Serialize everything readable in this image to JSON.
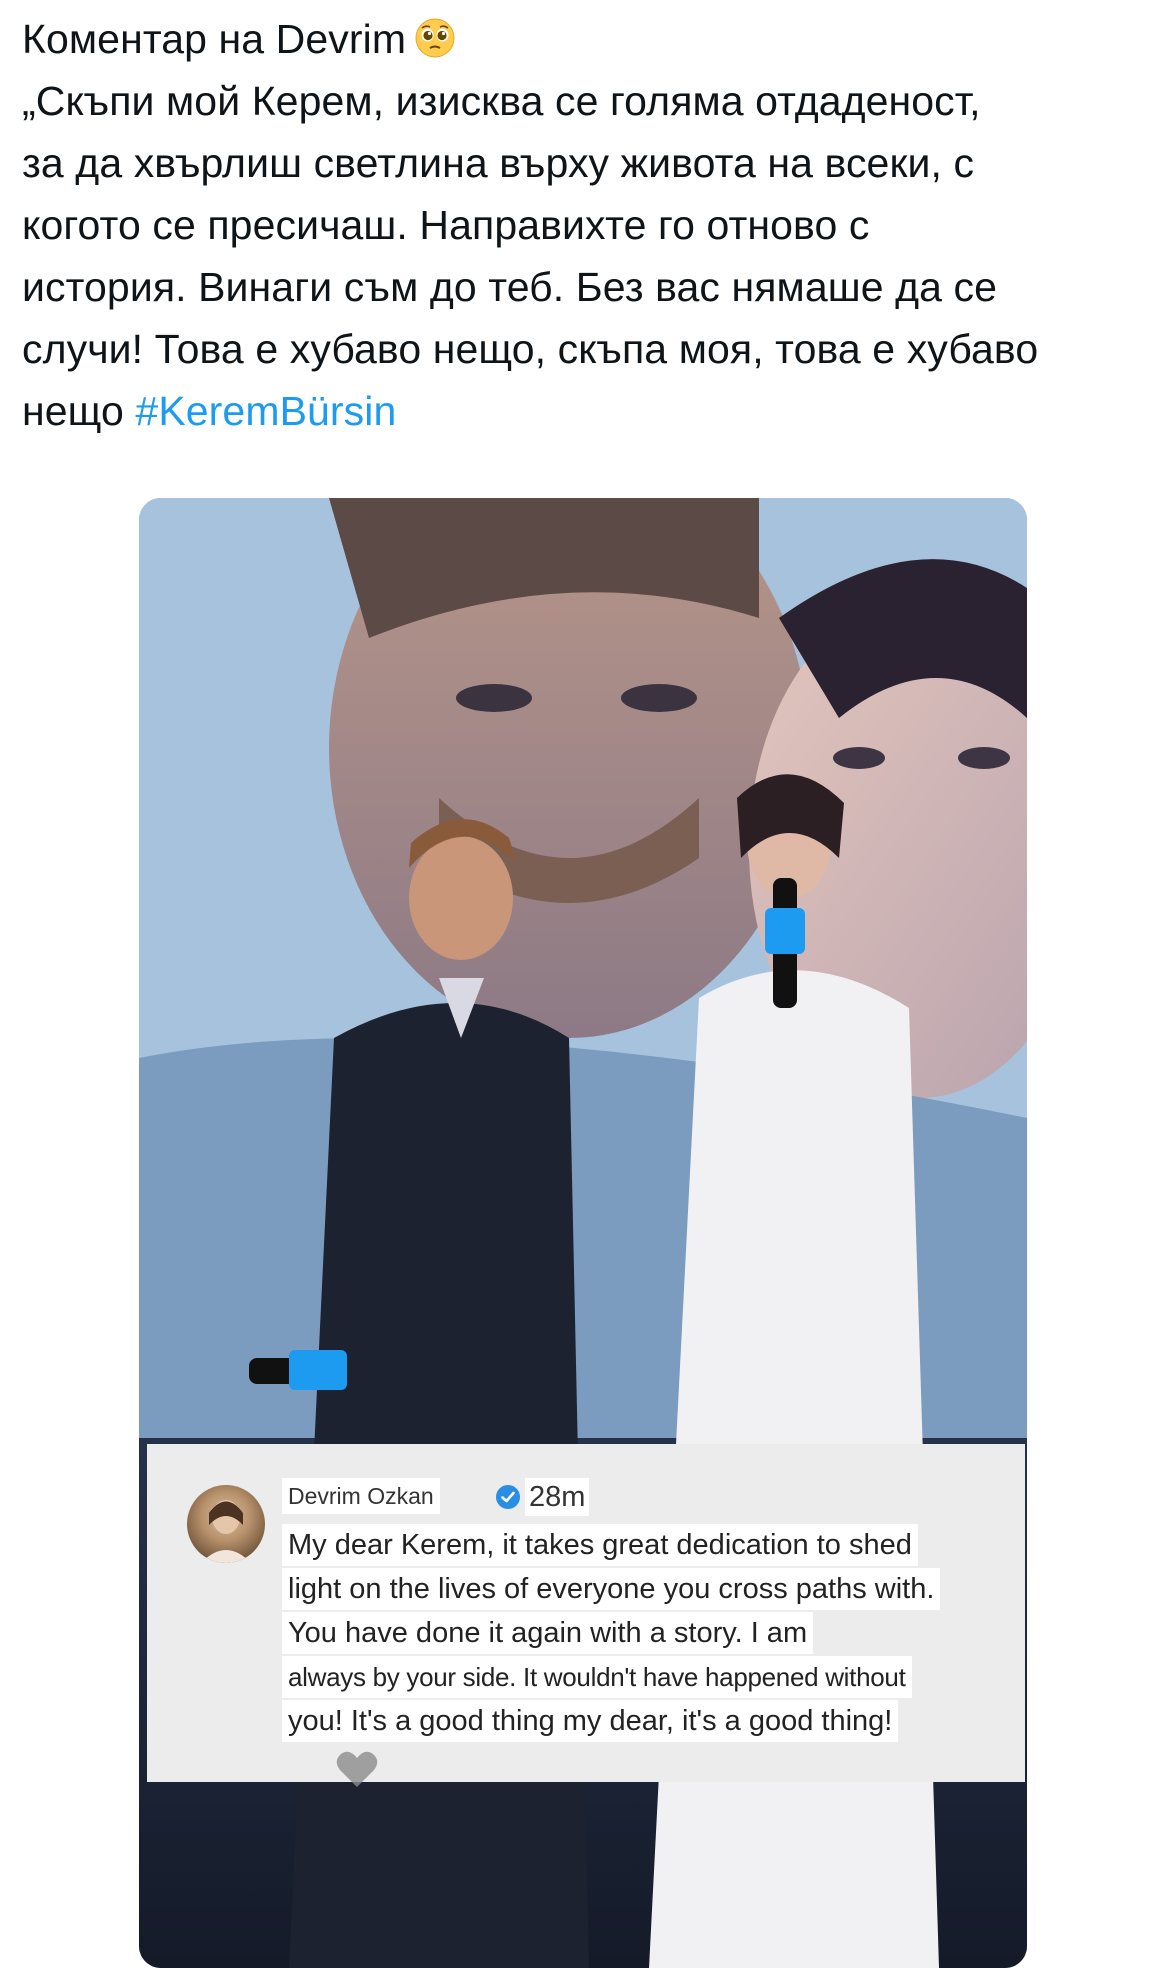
{
  "tweet": {
    "lines": [
      "Коментар на Devrim",
      "„Скъпи мой Керем, изисква се голяма отдаденост,",
      "за да хвърлиш светлина върху живота на всеки, с",
      "когото се пресичаш. Направихте го отново с",
      "история. Винаги съм до теб. Без вас нямаше да се",
      "случи! Това е хубаво нещо, скъпа моя, това е хубаво",
      "нещо"
    ],
    "hashtag": "#KeremBürsin",
    "emoji": "pleading-face-emoji",
    "link_color": "#1d9bf0"
  },
  "media": {
    "comment": {
      "author": "Devrim Ozkan",
      "time": "28m",
      "lines": [
        "My dear Kerem, it takes great dedication to shed",
        "light on the lives of everyone you cross paths with.",
        "You have done it again with a story. I am",
        "always by your side. It wouldn't have happened without",
        "you! It's a good thing my dear, it's a good thing!"
      ],
      "verified_icon": "verified-badge-icon",
      "reaction_icon": "heart-icon"
    }
  }
}
